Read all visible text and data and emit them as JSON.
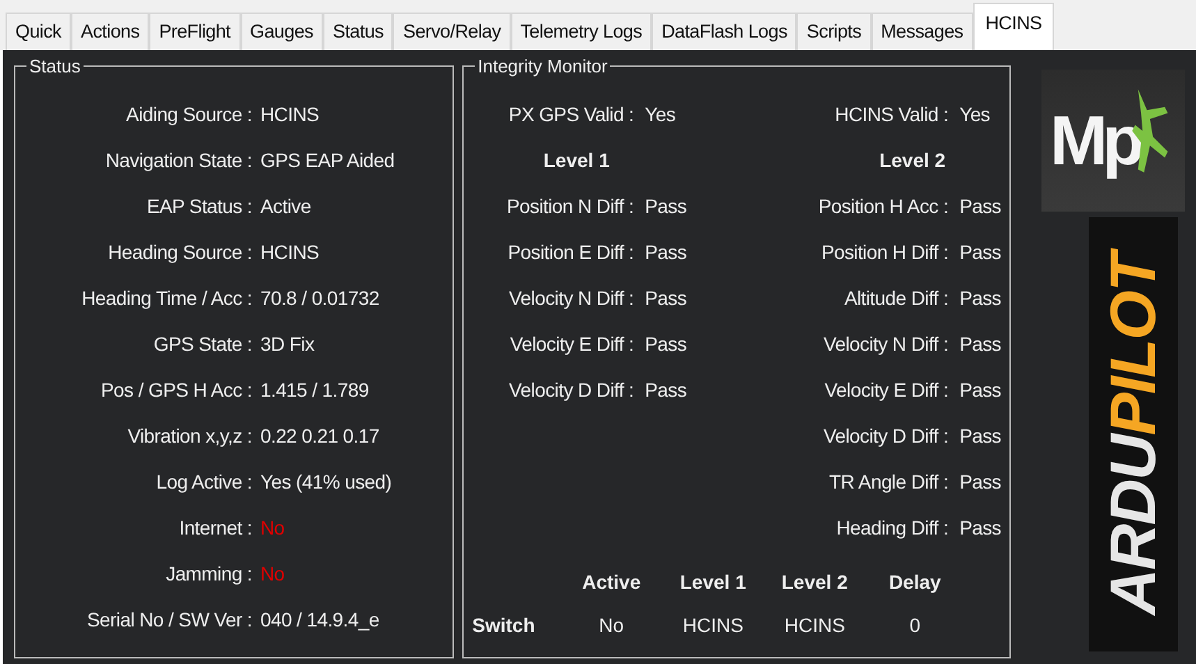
{
  "tabs": [
    {
      "label": "Quick",
      "selected": false
    },
    {
      "label": "Actions",
      "selected": false
    },
    {
      "label": "PreFlight",
      "selected": false
    },
    {
      "label": "Gauges",
      "selected": false
    },
    {
      "label": "Status",
      "selected": false
    },
    {
      "label": "Servo/Relay",
      "selected": false
    },
    {
      "label": "Telemetry Logs",
      "selected": false
    },
    {
      "label": "DataFlash Logs",
      "selected": false
    },
    {
      "label": "Scripts",
      "selected": false
    },
    {
      "label": "Messages",
      "selected": false
    },
    {
      "label": "HCINS",
      "selected": true
    }
  ],
  "status": {
    "title": "Status",
    "rows": [
      {
        "label": "Aiding Source :",
        "value": "HCINS",
        "alert": false
      },
      {
        "label": "Navigation State :",
        "value": "GPS EAP Aided",
        "alert": false
      },
      {
        "label": "EAP Status :",
        "value": "Active",
        "alert": false
      },
      {
        "label": "Heading Source :",
        "value": "HCINS",
        "alert": false
      },
      {
        "label": "Heading Time / Acc :",
        "value": "70.8 / 0.01732",
        "alert": false
      },
      {
        "label": "GPS State :",
        "value": "3D Fix",
        "alert": false
      },
      {
        "label": "Pos / GPS H Acc :",
        "value": "1.415 / 1.789",
        "alert": false
      },
      {
        "label": "Vibration x,y,z :",
        "value": "0.22 0.21 0.17",
        "alert": false
      },
      {
        "label": "Log Active :",
        "value": "Yes (41% used)",
        "alert": false
      },
      {
        "label": "Internet :",
        "value": "No",
        "alert": true
      },
      {
        "label": "Jamming :",
        "value": "No",
        "alert": true
      },
      {
        "label": "Serial No / SW Ver :",
        "value": "040 / 14.9.4_e",
        "alert": false
      }
    ]
  },
  "integrity": {
    "title": "Integrity Monitor",
    "valid": [
      {
        "label": "PX GPS Valid :",
        "value": "Yes"
      },
      {
        "label": "HCINS Valid :",
        "value": "Yes"
      }
    ],
    "level_1": {
      "heading": "Level 1",
      "rows": [
        {
          "label": "Position N Diff :",
          "value": "Pass"
        },
        {
          "label": "Position E Diff :",
          "value": "Pass"
        },
        {
          "label": "Velocity N Diff :",
          "value": "Pass"
        },
        {
          "label": "Velocity E Diff :",
          "value": "Pass"
        },
        {
          "label": "Velocity D Diff :",
          "value": "Pass"
        }
      ]
    },
    "level_2": {
      "heading": "Level 2",
      "rows": [
        {
          "label": "Position H Acc :",
          "value": "Pass"
        },
        {
          "label": "Position H Diff :",
          "value": "Pass"
        },
        {
          "label": "Altitude Diff :",
          "value": "Pass"
        },
        {
          "label": "Velocity N Diff :",
          "value": "Pass"
        },
        {
          "label": "Velocity E Diff :",
          "value": "Pass"
        },
        {
          "label": "Velocity D Diff :",
          "value": "Pass"
        },
        {
          "label": "TR Angle Diff :",
          "value": "Pass"
        },
        {
          "label": "Heading Diff :",
          "value": "Pass"
        }
      ]
    },
    "switch_table": {
      "columns": [
        "Active",
        "Level 1",
        "Level 2",
        "Delay"
      ],
      "row_label": "Switch",
      "cells": [
        "No",
        "HCINS",
        "HCINS",
        "0"
      ]
    }
  },
  "logos": {
    "mp": "Mp",
    "ardupilot": [
      {
        "text": "ARDU",
        "kind": "plain"
      },
      {
        "text": "PILOT",
        "kind": "accent"
      }
    ]
  }
}
